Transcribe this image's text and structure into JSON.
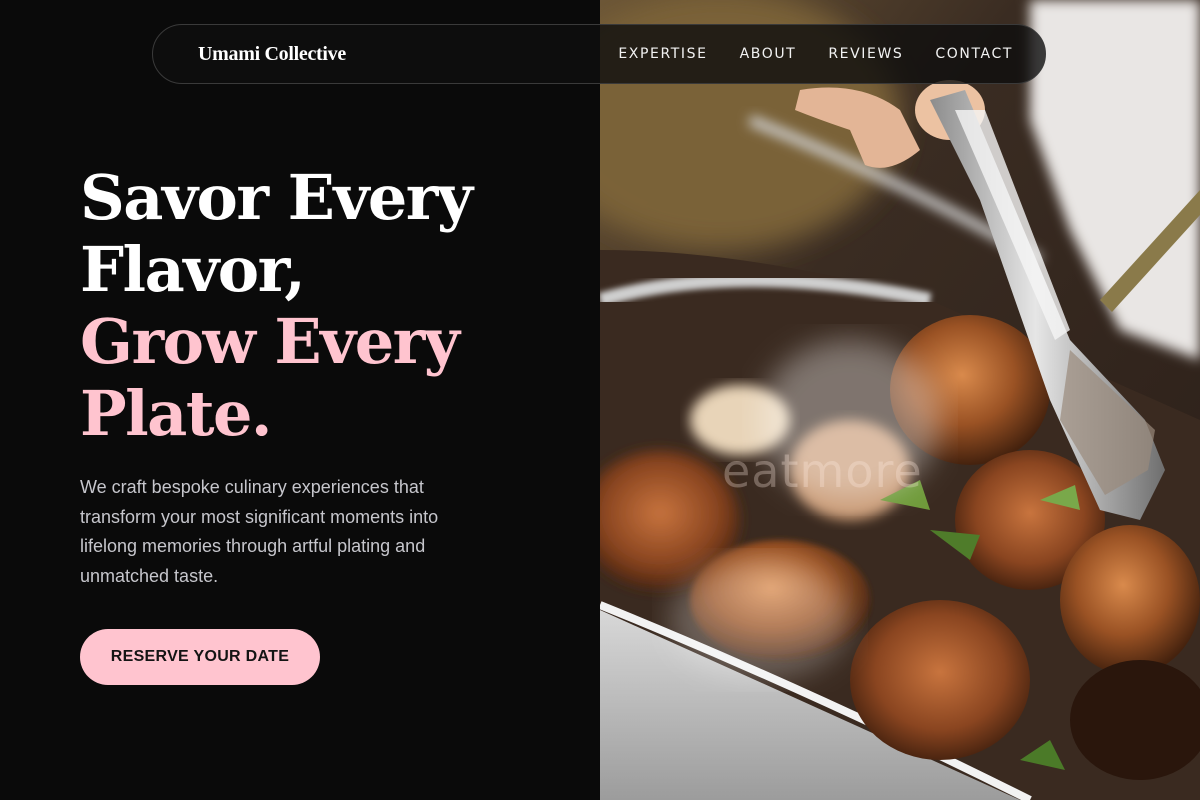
{
  "nav": {
    "brand": "Umami Collective",
    "links": [
      {
        "label": "EXPERTISE"
      },
      {
        "label": "ABOUT"
      },
      {
        "label": "REVIEWS"
      },
      {
        "label": "CONTACT"
      }
    ]
  },
  "hero": {
    "title_line1": "Savor Every",
    "title_line2": "Flavor,",
    "title_line3": "Grow Every",
    "title_line4": "Plate.",
    "description": "We craft bespoke culinary experiences that transform your most significant moments into lifelong memories through artful plating and unmatched taste.",
    "cta_label": "RESERVE YOUR DATE",
    "image_watermark": "eatmore"
  },
  "colors": {
    "background": "#0a0a0a",
    "accent_pink": "#ffc4cf",
    "text_primary": "#ffffff",
    "text_secondary": "#c6c6cc"
  },
  "icons": {
    "hero_image": "grilled-chicken-with-tongs-photo"
  }
}
